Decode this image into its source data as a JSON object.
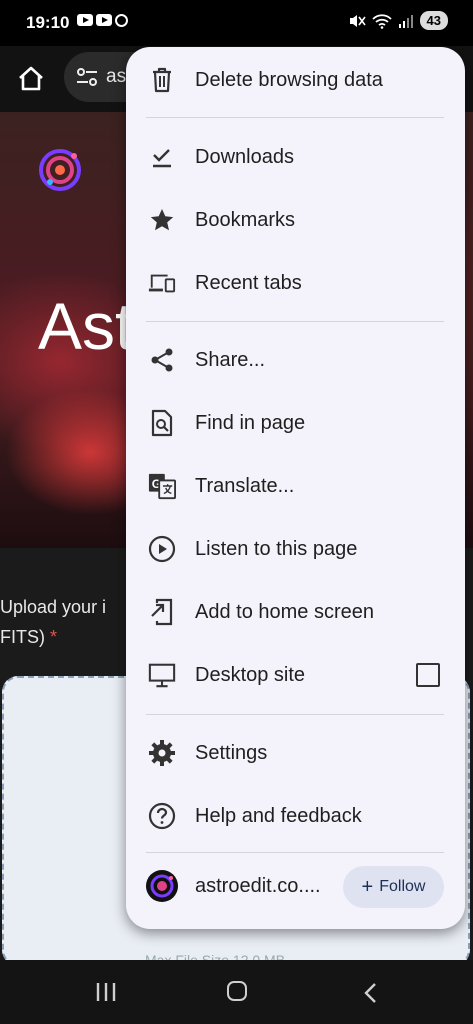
{
  "status_bar": {
    "time": "19:10",
    "battery": "43"
  },
  "toolbar": {
    "url_text": "as"
  },
  "page": {
    "hero_title": "Ast",
    "upload_label": "Upload your i",
    "upload_label_2": "FITS)",
    "required_mark": "*",
    "max_size": "Max File Size 12.0 MB"
  },
  "menu": {
    "items": [
      {
        "label": "Delete browsing data",
        "icon": "trash-icon"
      },
      {
        "label": "Downloads",
        "icon": "download-done-icon"
      },
      {
        "label": "Bookmarks",
        "icon": "star-icon"
      },
      {
        "label": "Recent tabs",
        "icon": "devices-icon"
      },
      {
        "label": "Share...",
        "icon": "share-icon"
      },
      {
        "label": "Find in page",
        "icon": "find-in-page-icon"
      },
      {
        "label": "Translate...",
        "icon": "translate-icon"
      },
      {
        "label": "Listen to this page",
        "icon": "play-circle-icon"
      },
      {
        "label": "Add to home screen",
        "icon": "add-to-home-icon"
      },
      {
        "label": "Desktop site",
        "icon": "desktop-icon"
      },
      {
        "label": "Settings",
        "icon": "gear-icon"
      },
      {
        "label": "Help and feedback",
        "icon": "help-icon"
      }
    ],
    "desktop_site_checked": false,
    "site": {
      "name": "astroedit.co....",
      "follow_label": "Follow"
    }
  },
  "colors": {
    "menu_bg": "#f4f3fb",
    "follow_bg": "#dfe3f1",
    "accent_text": "#1d2f55"
  }
}
